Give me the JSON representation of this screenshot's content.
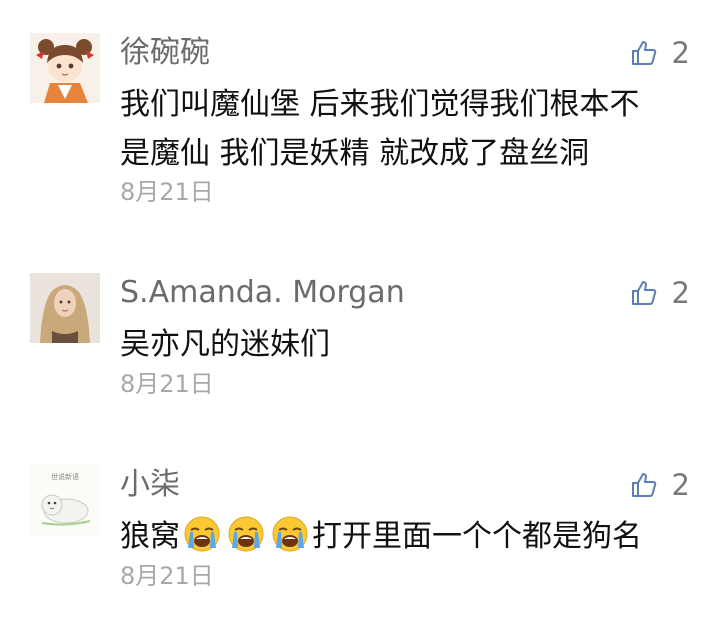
{
  "comments": [
    {
      "username": "徐碗碗",
      "avatar_icon": "anime-girl-avatar",
      "likes": "2",
      "lines": [
        "我们叫魔仙堡  后来我们觉得我们根本不",
        "是魔仙   我们是妖精  就改成了盘丝洞"
      ],
      "date": "8月21日"
    },
    {
      "username": "S.Amanda. Morgan",
      "avatar_icon": "woman-photo-avatar",
      "likes": "2",
      "lines": [
        "吴亦凡的迷妹们"
      ],
      "date": "8月21日"
    },
    {
      "username": "小柒",
      "avatar_icon": "seal-cartoon-avatar",
      "avatar_caption": "世说新语",
      "likes": "2",
      "text_before": "狼窝",
      "emoji_icon": "loudly-crying-face",
      "text_after": "打开里面一个个都是狗名",
      "date": "8月21日"
    }
  ],
  "colors": {
    "username": "#6b6b6b",
    "body": "#111111",
    "date": "#a8a8a8",
    "like_icon": "#5b7fb5",
    "like_count": "#7a7a7a"
  }
}
